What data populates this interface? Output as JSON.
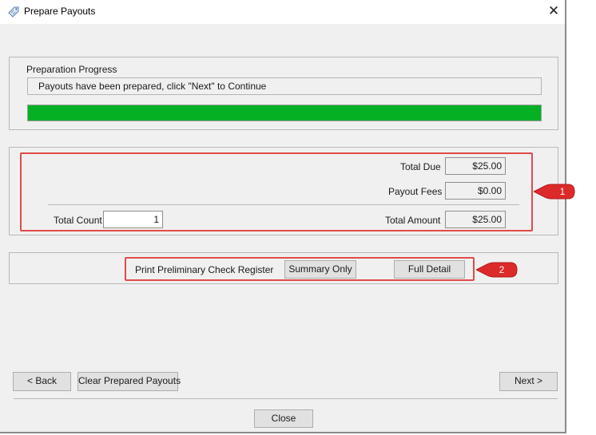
{
  "window": {
    "title": "Prepare Payouts",
    "close_glyph": "✕",
    "icon": "tag-icon"
  },
  "progress": {
    "heading": "Preparation Progress",
    "message": "Payouts have been prepared, click \"Next\" to Continue",
    "value_percent": 100,
    "color": "#06b025"
  },
  "totals": {
    "total_due_label": "Total Due",
    "total_due_value": "$25.00",
    "payout_fees_label": "Payout Fees",
    "payout_fees_value": "$0.00",
    "total_count_label": "Total Count",
    "total_count_value": "1",
    "total_amount_label": "Total Amount",
    "total_amount_value": "$25.00"
  },
  "register": {
    "label": "Print Preliminary Check Register",
    "summary_button": "Summary Only",
    "full_detail_button": "Full Detail"
  },
  "footer": {
    "back_button": "< Back",
    "clear_button": "Clear Prepared Payouts",
    "next_button": "Next >",
    "close_button": "Close"
  },
  "annotations": [
    {
      "number": "1",
      "color": "#e14a4a"
    },
    {
      "number": "2",
      "color": "#e14a4a"
    }
  ]
}
